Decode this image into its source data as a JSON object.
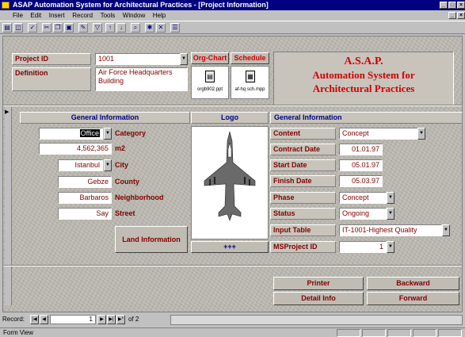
{
  "window": {
    "title": "ASAP Automation System for Architectural Practices - [Project Information]"
  },
  "menu": [
    "File",
    "Edit",
    "Insert",
    "Record",
    "Tools",
    "Window",
    "Help"
  ],
  "toolbar_icons": [
    "print-icon",
    "preview-icon",
    "spell-icon",
    "cut-icon",
    "copy-icon",
    "paste-icon",
    "format-painter-icon",
    "filter-icon",
    "sort-asc-icon",
    "sort-desc-icon",
    "find-icon",
    "new-record-icon",
    "delete-icon",
    "properties-icon"
  ],
  "header": {
    "project_id_label": "Project ID",
    "project_id_value": "1001",
    "definition_label": "Definition",
    "definition_value": "Air Force Headquarters Building",
    "orgchart_label": "Org-Chart",
    "orgchart_file": "orgb902.ppt",
    "schedule_label": "Schedule",
    "schedule_file": "af-hq sch.mpp",
    "brand_line1": "A.S.A.P.",
    "brand_line2": "Automation System for",
    "brand_line3": "Architectural Practices"
  },
  "left": {
    "title": "General Information",
    "rows": [
      {
        "label": "Category",
        "value": "Office"
      },
      {
        "label": "m2",
        "value": "4,562,365"
      },
      {
        "label": "City",
        "value": "Istanbul"
      },
      {
        "label": "County",
        "value": "Gebze"
      },
      {
        "label": "Neighborhood",
        "value": "Barbaros"
      },
      {
        "label": "Street",
        "value": "Say"
      }
    ],
    "land_button": "Land Information"
  },
  "logo": {
    "title": "Logo",
    "more": "+++"
  },
  "right": {
    "title": "General Information",
    "rows": [
      {
        "label": "Content",
        "value": "Concept"
      },
      {
        "label": "Contract Date",
        "value": "01.01.97"
      },
      {
        "label": "Start Date",
        "value": "05.01.97"
      },
      {
        "label": "Finish Date",
        "value": "05.03.97"
      },
      {
        "label": "Phase",
        "value": "Concept"
      },
      {
        "label": "Status",
        "value": "Ongoing"
      },
      {
        "label": "Input Table",
        "value": "IT-1001-Highest Quality"
      },
      {
        "label": "MSProject ID",
        "value": "1"
      }
    ]
  },
  "buttons": {
    "printer": "Printer",
    "backward": "Backward",
    "detail": "Detail Info",
    "forward": "Forward"
  },
  "navigation": {
    "record_label": "Record:",
    "current": "1",
    "total": "of 2"
  },
  "status": {
    "text": "Form View"
  }
}
